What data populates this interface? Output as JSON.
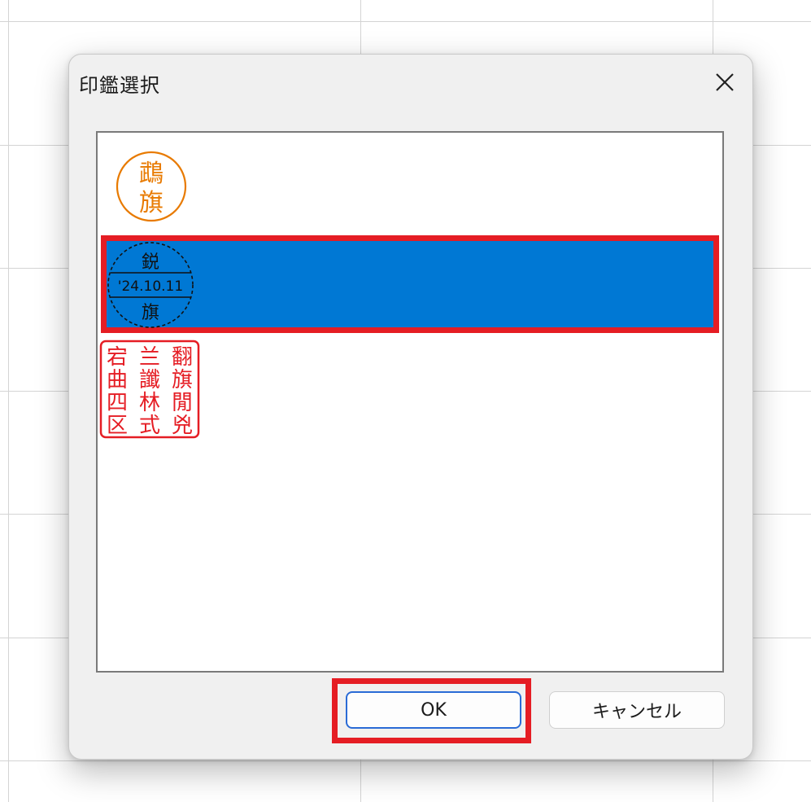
{
  "dialog": {
    "title": "印鑑選択",
    "close_icon": "close-icon"
  },
  "seals": [
    {
      "name": "name-seal",
      "color": "#e87a00",
      "chars": [
        "鵡",
        "旗"
      ]
    },
    {
      "name": "date-seal",
      "color": "#111111",
      "date": "'24.10.11",
      "chars": [
        "鋭",
        "旗"
      ],
      "selected": true
    },
    {
      "name": "corporate-seal",
      "color": "#e51d24",
      "chars": [
        "宕",
        "曲",
        "四",
        "区",
        "兰",
        "讖",
        "林",
        "式",
        "翻",
        "旗",
        "閒",
        "兇"
      ]
    }
  ],
  "buttons": {
    "ok_label": "OK",
    "cancel_label": "キャンセル"
  },
  "colors": {
    "selection": "#0078d4",
    "highlight": "#e51d24",
    "dialog_bg": "#f0f0f0"
  }
}
